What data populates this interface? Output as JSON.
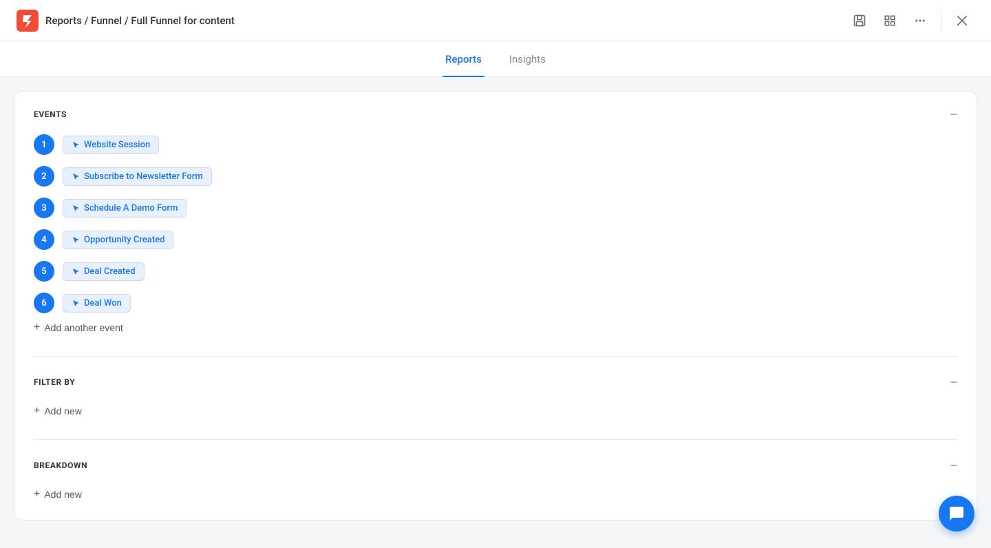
{
  "header": {
    "breadcrumb": "Reports / Funnel / Full Funnel for content",
    "icons": {
      "save": "⊡",
      "grid": "⊞",
      "more": "•••",
      "close": "×"
    }
  },
  "tabs": [
    {
      "id": "reports",
      "label": "Reports",
      "active": true
    },
    {
      "id": "insights",
      "label": "Insights",
      "active": false
    }
  ],
  "events_section": {
    "title": "EVENTS",
    "collapse_icon": "−",
    "items": [
      {
        "number": "1",
        "label": "Website Session"
      },
      {
        "number": "2",
        "label": "Subscribe to Newsletter Form"
      },
      {
        "number": "3",
        "label": "Schedule A Demo Form"
      },
      {
        "number": "4",
        "label": "Opportunity Created"
      },
      {
        "number": "5",
        "label": "Deal Created"
      },
      {
        "number": "6",
        "label": "Deal Won"
      }
    ],
    "add_button": "Add another event"
  },
  "filter_section": {
    "title": "FILTER BY",
    "collapse_icon": "−",
    "add_button": "Add new"
  },
  "breakdown_section": {
    "title": "BREAKDOWN",
    "collapse_icon": "−",
    "add_button": "Add new"
  },
  "colors": {
    "brand_blue": "#1877f2",
    "tag_bg": "#e8f0fe",
    "tag_border": "#c5d9fa"
  }
}
